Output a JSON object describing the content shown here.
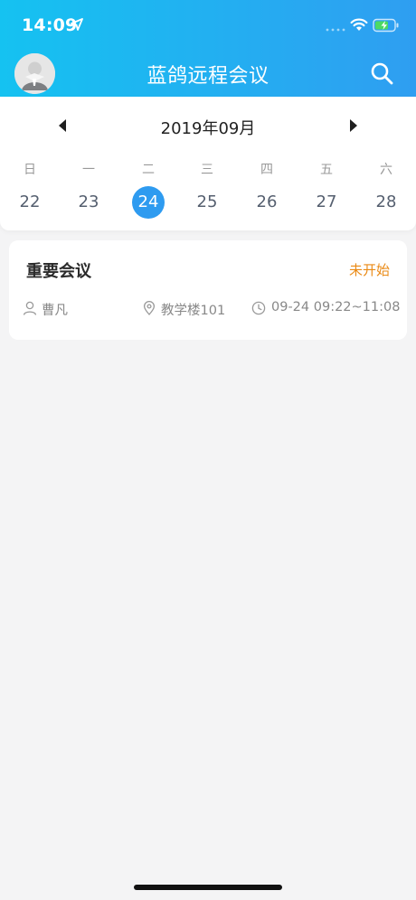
{
  "status_bar": {
    "time": "14:09",
    "icons": [
      "location-arrow-icon",
      "cellular-signal-icon",
      "wifi-icon",
      "battery-charging-icon"
    ]
  },
  "header": {
    "title": "蓝鸽远程会议",
    "left_icon": "user-avatar",
    "right_icon": "search-icon",
    "gradient": [
      "#15c2f1",
      "#2f9ef1"
    ]
  },
  "calendar": {
    "month_label": "2019年09月",
    "prev_icon": "triangle-left-icon",
    "next_icon": "triangle-right-icon",
    "weekdays": [
      "日",
      "一",
      "二",
      "三",
      "四",
      "五",
      "六"
    ],
    "dates": [
      "22",
      "23",
      "24",
      "25",
      "26",
      "27",
      "28"
    ],
    "selected_date": "24",
    "accent_color": "#2e9bf0"
  },
  "meetings": [
    {
      "title": "重要会议",
      "status": "未开始",
      "status_color": "#ea8a15",
      "host": "曹凡",
      "location": "教学楼101",
      "time": "09-24 09:22~11:08"
    }
  ]
}
